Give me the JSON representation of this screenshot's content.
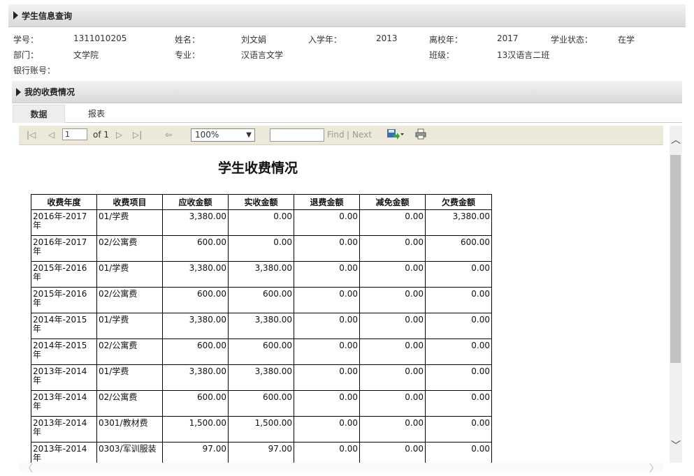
{
  "header": {
    "title": "学生信息查询"
  },
  "student": {
    "id_label": "学号：",
    "id_value": "1311010205",
    "name_label": "姓名：",
    "name_value": "刘文娟",
    "enroll_label": "入学年：",
    "enroll_value": "2013",
    "leave_label": "离校年：",
    "leave_value": "2017",
    "status_label": "学业状态：",
    "status_value": "在学",
    "dept_label": "部门：",
    "dept_value": "文学院",
    "major_label": "专业：",
    "major_value": "汉语言文学",
    "class_label": "班级：",
    "class_value": "13汉语言二班",
    "bank_label": "银行账号：",
    "bank_value": ""
  },
  "fees_section": {
    "title": "我的收费情况"
  },
  "tabs": [
    {
      "label": "数据"
    },
    {
      "label": "报表"
    }
  ],
  "toolbar": {
    "page_value": "1",
    "of_text": "of 1",
    "zoom_value": "100%",
    "find_label": "Find",
    "separator": "|",
    "next_label": "Next",
    "icons": [
      "first-page-icon",
      "prev-page-icon",
      "next-page-icon",
      "last-page-icon",
      "back-icon",
      "save-icon",
      "print-icon"
    ]
  },
  "report": {
    "title": "学生收费情况",
    "columns": [
      "收费年度",
      "收费项目",
      "应收金额",
      "实收金额",
      "退费金额",
      "减免金额",
      "欠费金额"
    ],
    "rows": [
      [
        "2016年-2017年",
        "01/学费",
        "3,380.00",
        "0.00",
        "0.00",
        "0.00",
        "3,380.00"
      ],
      [
        "2016年-2017年",
        "02/公寓费",
        "600.00",
        "0.00",
        "0.00",
        "0.00",
        "600.00"
      ],
      [
        "2015年-2016年",
        "01/学费",
        "3,380.00",
        "3,380.00",
        "0.00",
        "0.00",
        "0.00"
      ],
      [
        "2015年-2016年",
        "02/公寓费",
        "600.00",
        "600.00",
        "0.00",
        "0.00",
        "0.00"
      ],
      [
        "2014年-2015年",
        "01/学费",
        "3,380.00",
        "3,380.00",
        "0.00",
        "0.00",
        "0.00"
      ],
      [
        "2014年-2015年",
        "02/公寓费",
        "600.00",
        "600.00",
        "0.00",
        "0.00",
        "0.00"
      ],
      [
        "2013年-2014年",
        "01/学费",
        "3,380.00",
        "3,380.00",
        "0.00",
        "0.00",
        "0.00"
      ],
      [
        "2013年-2014年",
        "02/公寓费",
        "600.00",
        "600.00",
        "0.00",
        "0.00",
        "0.00"
      ],
      [
        "2013年-2014年",
        "0301/教材费",
        "1,500.00",
        "1,500.00",
        "0.00",
        "0.00",
        "0.00"
      ],
      [
        "2013年-2014年",
        "0303/军训服装",
        "97.00",
        "97.00",
        "0.00",
        "0.00",
        "0.00"
      ]
    ]
  }
}
